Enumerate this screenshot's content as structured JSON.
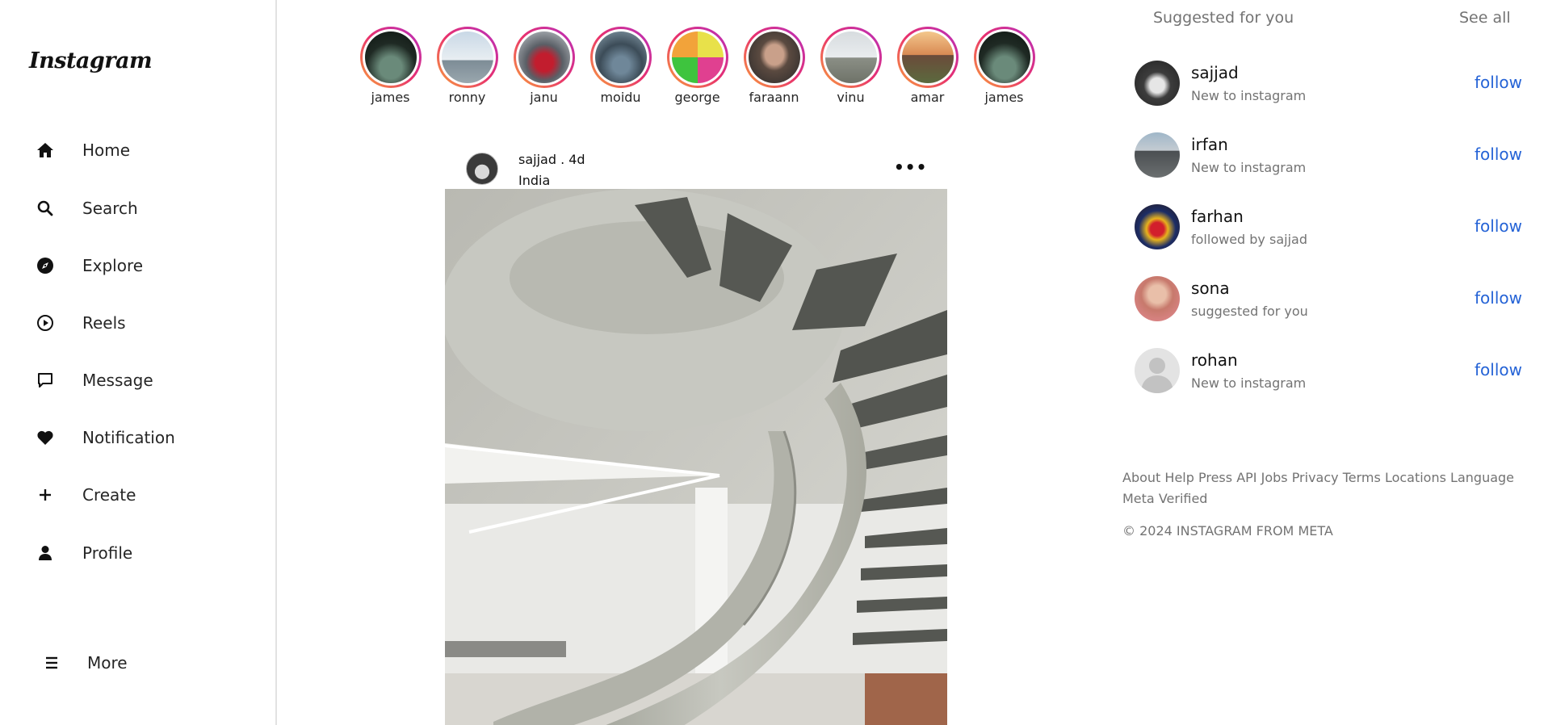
{
  "sidebar": {
    "logo": "Instagram",
    "items": [
      {
        "label": "Home",
        "icon": "home-icon"
      },
      {
        "label": "Search",
        "icon": "search-icon"
      },
      {
        "label": "Explore",
        "icon": "compass-icon"
      },
      {
        "label": "Reels",
        "icon": "play-circle-icon"
      },
      {
        "label": "Message",
        "icon": "message-icon"
      },
      {
        "label": "Notification",
        "icon": "heart-icon"
      },
      {
        "label": "Create",
        "icon": "plus-icon"
      },
      {
        "label": "Profile",
        "icon": "user-icon"
      }
    ],
    "more": {
      "label": "More",
      "icon": "menu-icon"
    }
  },
  "stories": [
    {
      "name": "james"
    },
    {
      "name": "ronny"
    },
    {
      "name": "janu"
    },
    {
      "name": "moidu"
    },
    {
      "name": "george"
    },
    {
      "name": "faraann"
    },
    {
      "name": "vinu"
    },
    {
      "name": "amar"
    },
    {
      "name": "james"
    }
  ],
  "post": {
    "user": "sajjad . 4d",
    "location": "India",
    "more_label": "•••"
  },
  "suggestions": {
    "title": "Suggested for you",
    "see_all": "See all",
    "items": [
      {
        "name": "sajjad",
        "sub": "New to instagram",
        "action": "follow"
      },
      {
        "name": "irfan",
        "sub": "New to instagram",
        "action": "follow"
      },
      {
        "name": "farhan",
        "sub": "followed by sajjad",
        "action": "follow"
      },
      {
        "name": "sona",
        "sub": "suggested for you",
        "action": "follow"
      },
      {
        "name": "rohan",
        "sub": "New to instagram",
        "action": "follow"
      }
    ]
  },
  "footer": {
    "links": [
      "About",
      "Help",
      "Press",
      "API",
      "Jobs",
      "Privacy",
      "Terms",
      "Locations",
      "Language",
      "Meta Verified"
    ],
    "copyright": "© 2024 INSTAGRAM FROM META"
  },
  "colors": {
    "follow_link": "#2563d6",
    "muted_text": "#737373",
    "story_ring_start": "#f9a33a",
    "story_ring_mid": "#e8306e",
    "story_ring_end": "#b62fc0"
  }
}
